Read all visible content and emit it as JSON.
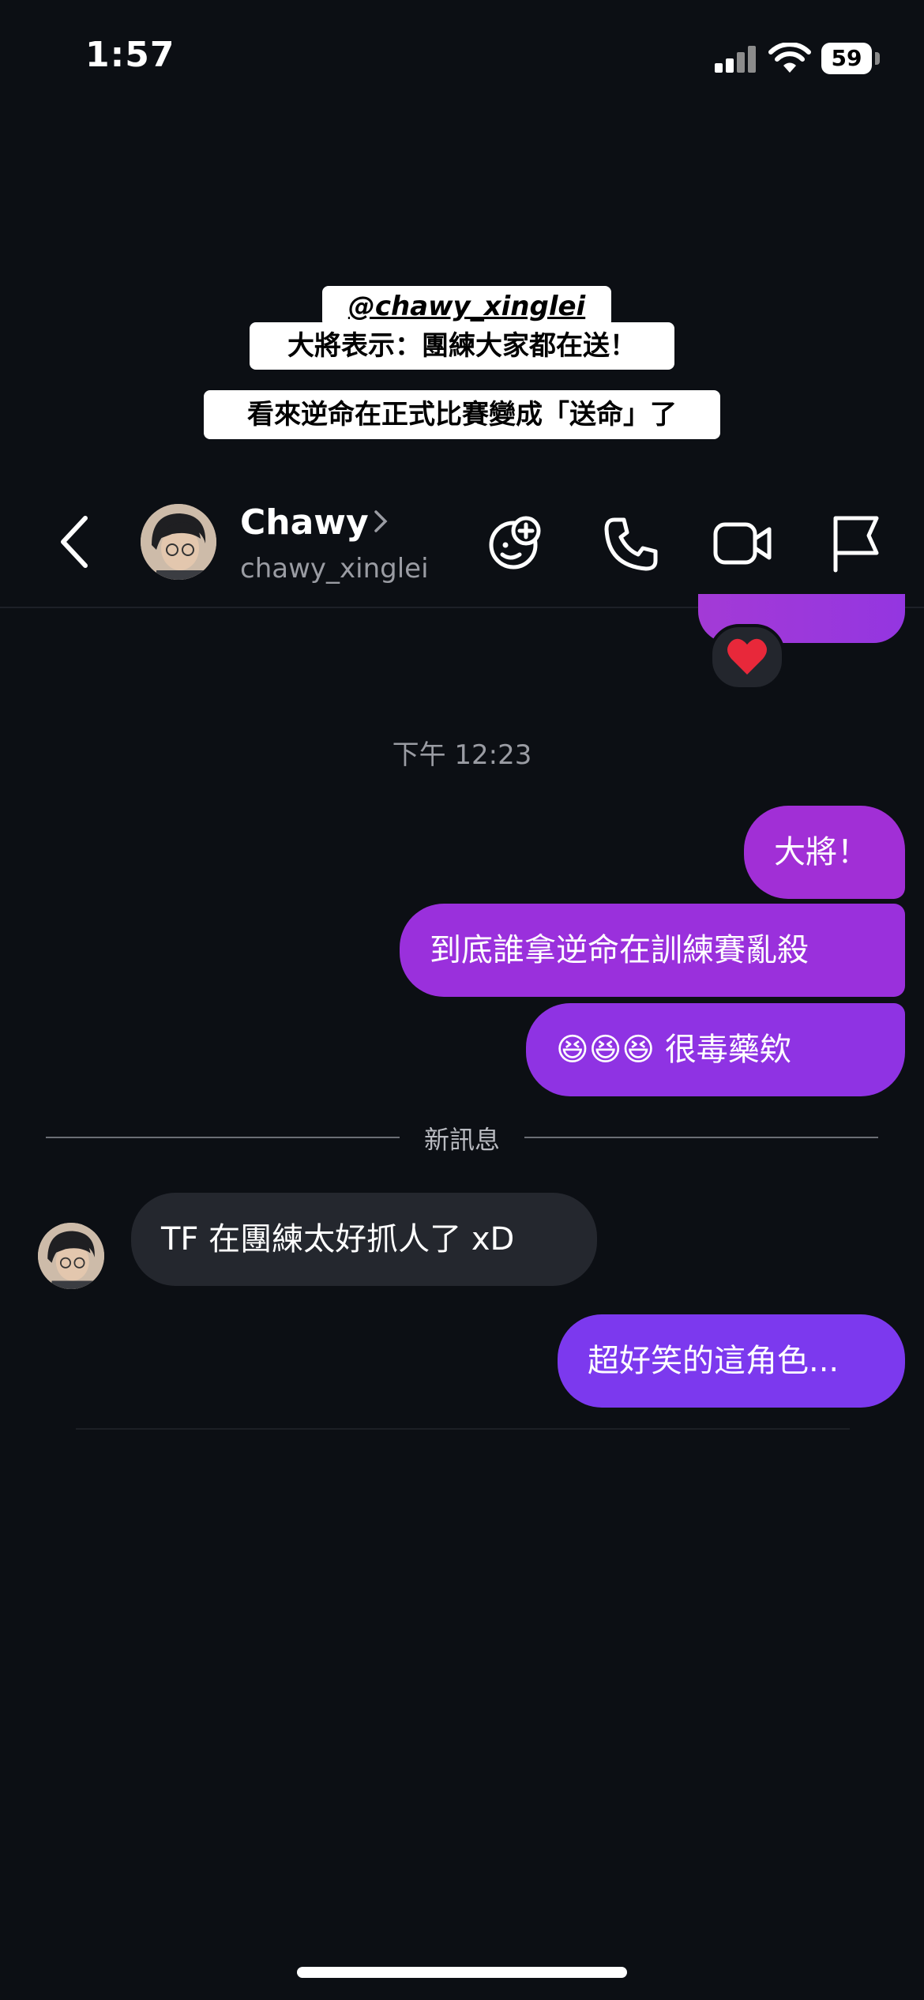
{
  "status_bar": {
    "time": "1:57",
    "battery": "59"
  },
  "story_captions": {
    "handle": "@chawy_xinglei",
    "line1": "大將表示：團練大家都在送！",
    "line2": "看來逆命在正式比賽變成「送命」了"
  },
  "header": {
    "name": "Chawy",
    "username": "chawy_xinglei"
  },
  "chat": {
    "reaction_emoji": "❤️",
    "timestamp": "下午 12:23",
    "outgoing": [
      "大將！",
      "到底誰拿逆命在訓練賽亂殺",
      "😆😆😆 很毒藥欸"
    ],
    "new_messages_label": "新訊息",
    "incoming": "TF 在團練太好抓人了 xD",
    "outgoing_last": "超好笑的這角色..."
  }
}
